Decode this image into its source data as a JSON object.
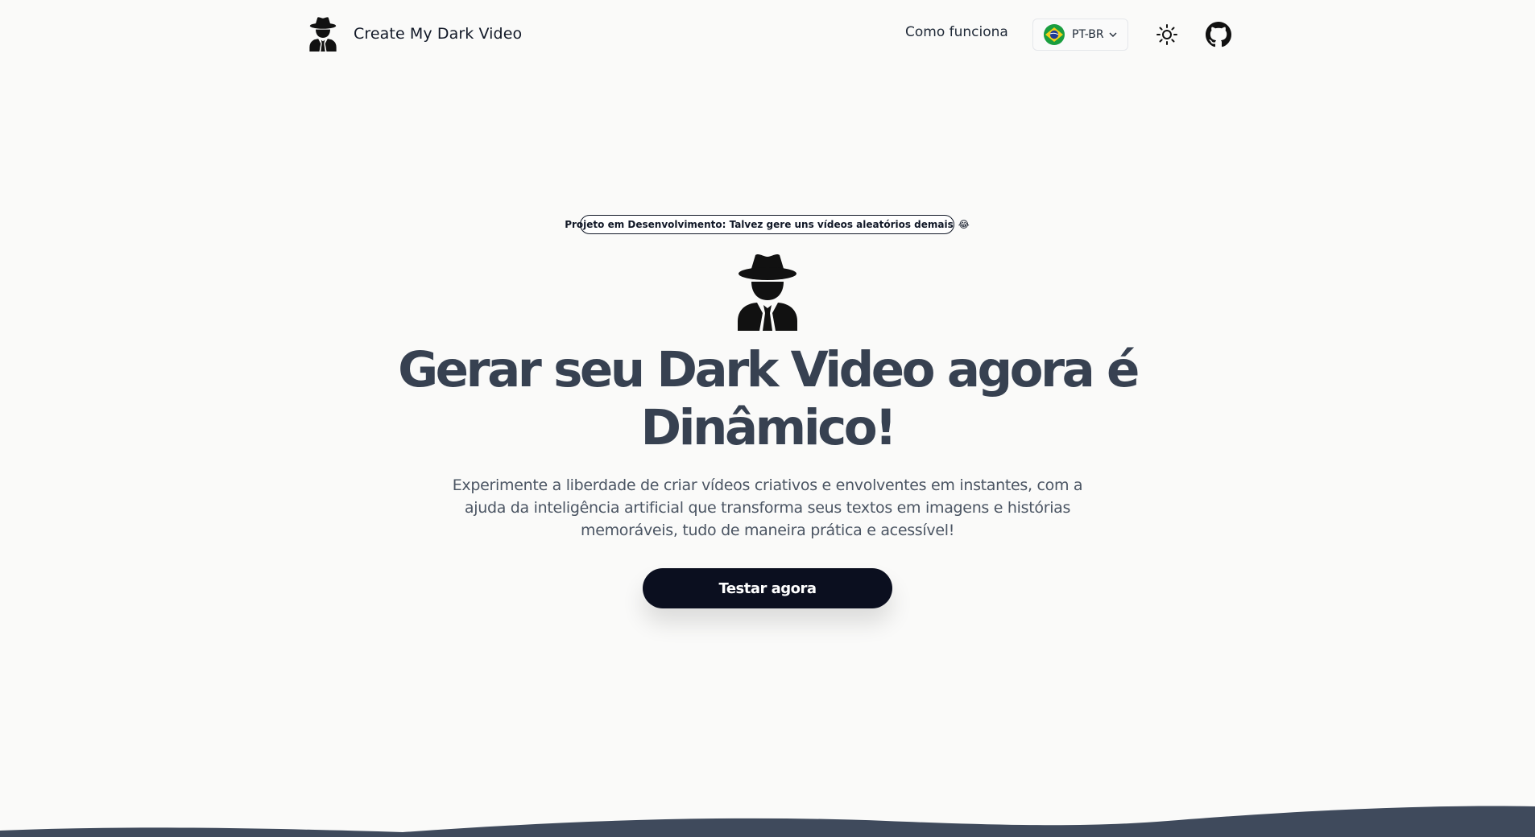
{
  "header": {
    "brand_name": "Create My Dark Video",
    "nav_link": "Como funciona",
    "language": {
      "selected": "PT-BR",
      "flag": "brazil-flag-icon"
    },
    "theme_icon": "sun-icon",
    "github_icon": "github-icon"
  },
  "hero": {
    "badge_text": "Projeto em Desenvolvimento: Talvez gere uns vídeos aleatórios demais",
    "badge_emoji": "😂",
    "logo_icon": "spy-icon",
    "title": "Gerar seu Dark Video agora é Dinâmico!",
    "description": "Experimente a liberdade de criar vídeos criativos e envolventes em instantes, com a ajuda da inteligência artificial que transforma seus textos em imagens e histórias memoráveis, tudo de maneira prática e acessível!",
    "cta_label": "Testar agora"
  },
  "colors": {
    "background": "#fafaf9",
    "title": "#374151",
    "cta_background": "#0b0f1f",
    "wave": "#3f4a5c"
  }
}
